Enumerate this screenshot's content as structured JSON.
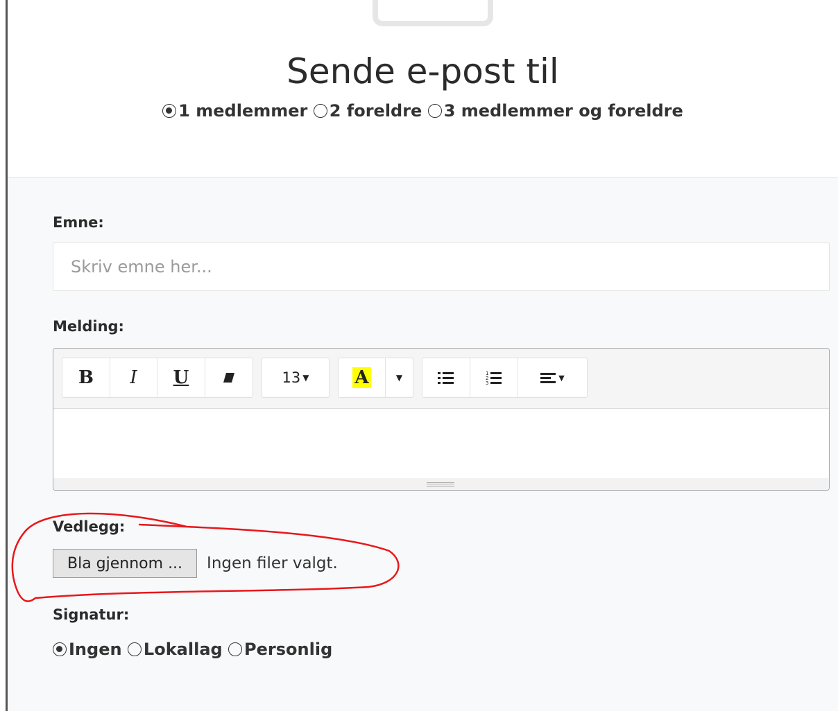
{
  "header": {
    "title": "Sende e-post til",
    "recipients": [
      {
        "label": "1 medlemmer",
        "checked": true
      },
      {
        "label": "2 foreldre",
        "checked": false
      },
      {
        "label": "3 medlemmer og foreldre",
        "checked": false
      }
    ]
  },
  "form": {
    "subject_label": "Emne:",
    "subject_placeholder": "Skriv emne her...",
    "subject_value": "",
    "message_label": "Melding:",
    "toolbar": {
      "bold": "B",
      "italic": "I",
      "underline": "U",
      "eraser_icon": "eraser-icon",
      "font_size": "13",
      "text_color_letter": "A",
      "text_color_highlight": "#ffff00",
      "bullet_list_icon": "bullet-list-icon",
      "numbered_list_icon": "numbered-list-icon",
      "align_icon": "align-left-icon"
    },
    "attachment_label": "Vedlegg:",
    "file_button_label": "Bla gjennom ...",
    "file_status": "Ingen filer valgt.",
    "signature_label": "Signatur:",
    "signatures": [
      {
        "label": "Ingen",
        "checked": true
      },
      {
        "label": "Lokallag",
        "checked": false
      },
      {
        "label": "Personlig",
        "checked": false
      }
    ]
  },
  "colors": {
    "annotation": "#e8171b",
    "form_background": "#f8f9fa",
    "highlight": "#ffff00"
  }
}
